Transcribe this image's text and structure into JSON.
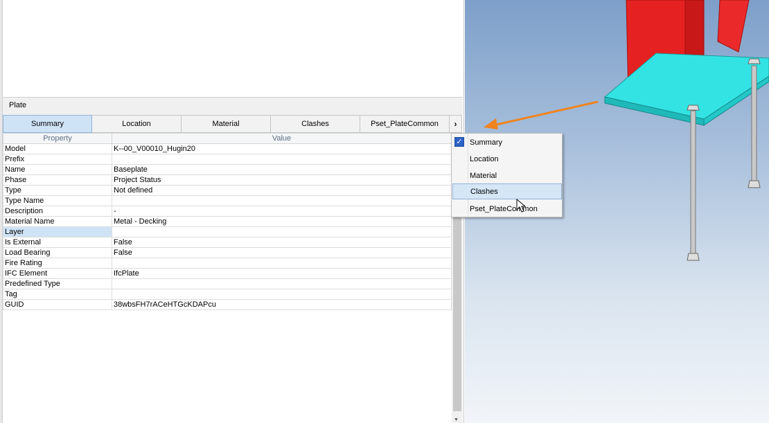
{
  "panel": {
    "title": "Plate"
  },
  "tabs": [
    "Summary",
    "Location",
    "Material",
    "Clashes",
    "Pset_PlateCommon"
  ],
  "tab_more_icon": "›",
  "table": {
    "headers": {
      "property": "Property",
      "value": "Value"
    },
    "rows": [
      {
        "property": "Model",
        "value": "K--00_V00010_Hugin20"
      },
      {
        "property": "Prefix",
        "value": ""
      },
      {
        "property": "Name",
        "value": "Baseplate"
      },
      {
        "property": "Phase",
        "value": "Project Status"
      },
      {
        "property": "Type",
        "value": "Not defined"
      },
      {
        "property": "Type Name",
        "value": ""
      },
      {
        "property": "Description",
        "value": "-"
      },
      {
        "property": "Material Name",
        "value": "Metal - Decking"
      },
      {
        "property": "Layer",
        "value": ""
      },
      {
        "property": "Is External",
        "value": "False"
      },
      {
        "property": "Load Bearing",
        "value": "False"
      },
      {
        "property": "Fire Rating",
        "value": ""
      },
      {
        "property": "IFC Element",
        "value": "IfcPlate"
      },
      {
        "property": "Predefined Type",
        "value": ""
      },
      {
        "property": "Tag",
        "value": ""
      },
      {
        "property": "GUID",
        "value": "38wbsFH7rACeHTGcKDAPcu"
      }
    ],
    "selected_row": "Layer"
  },
  "dropdown": {
    "items": [
      {
        "label": "Summary",
        "checked": true
      },
      {
        "label": "Location",
        "checked": false
      },
      {
        "label": "Material",
        "checked": false
      },
      {
        "label": "Clashes",
        "checked": false
      },
      {
        "label": "Pset_PlateCommon",
        "checked": false
      }
    ],
    "hovered": "Clashes",
    "check_glyph": "✓"
  },
  "colors": {
    "accent_selection": "#cfe3f6",
    "arrow": "#f0841e",
    "steel_red": "#e52121",
    "plate_cyan": "#33e3e3"
  }
}
